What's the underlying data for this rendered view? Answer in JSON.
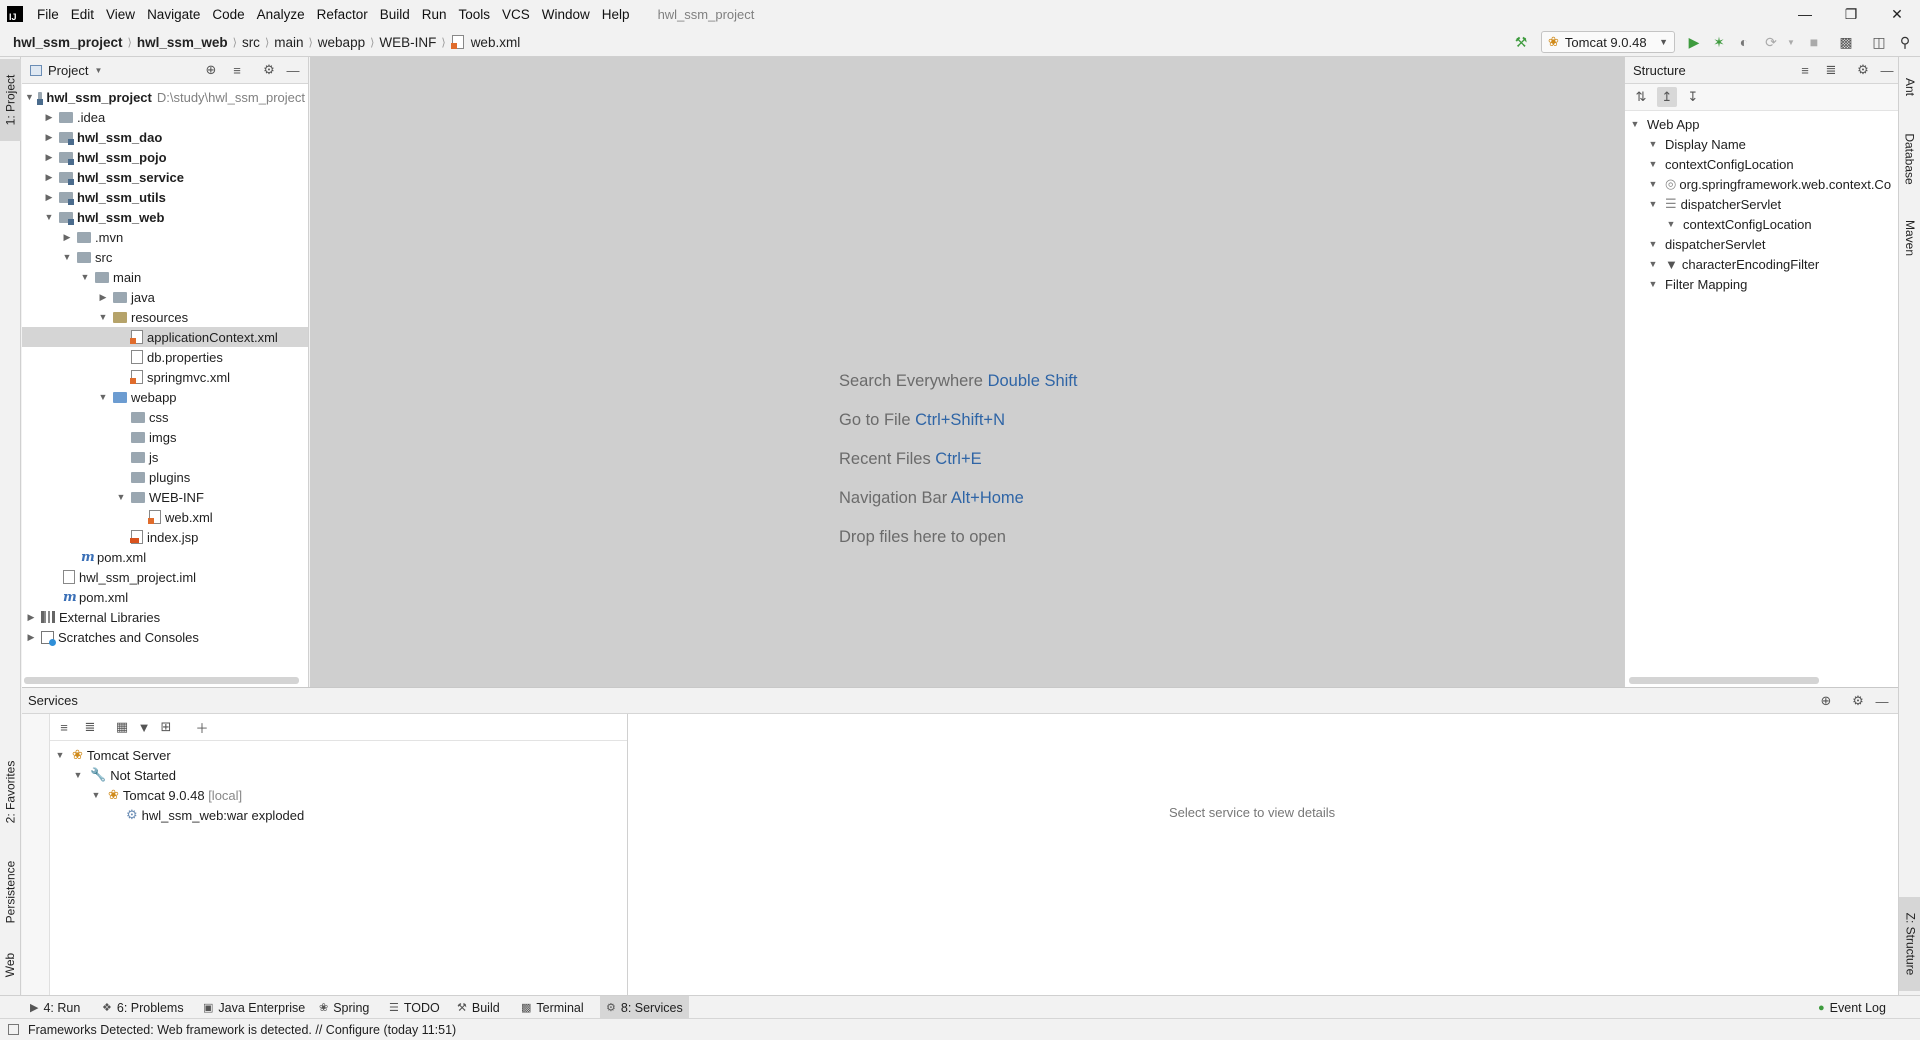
{
  "app": {
    "window_title": "hwl_ssm_project",
    "menu": [
      "File",
      "Edit",
      "View",
      "Navigate",
      "Code",
      "Analyze",
      "Refactor",
      "Build",
      "Run",
      "Tools",
      "VCS",
      "Window",
      "Help"
    ]
  },
  "breadcrumb": [
    "hwl_ssm_project",
    "hwl_ssm_web",
    "src",
    "main",
    "webapp",
    "WEB-INF",
    "web.xml"
  ],
  "run_config": {
    "label": "Tomcat 9.0.48"
  },
  "left_stripe": {
    "project": "1: Project",
    "favorites": "2: Favorites",
    "persistence": "Persistence",
    "web": "Web"
  },
  "right_stripe": {
    "ant": "Ant",
    "database": "Database",
    "maven": "Maven",
    "structure": "Z: Structure"
  },
  "project_panel": {
    "title": "Project",
    "tree": [
      {
        "label": "hwl_ssm_project",
        "path": "D:\\study\\hwl_ssm_project",
        "bold": true
      },
      {
        "label": ".idea"
      },
      {
        "label": "hwl_ssm_dao",
        "bold": true
      },
      {
        "label": "hwl_ssm_pojo",
        "bold": true
      },
      {
        "label": "hwl_ssm_service",
        "bold": true
      },
      {
        "label": "hwl_ssm_utils",
        "bold": true
      },
      {
        "label": "hwl_ssm_web",
        "bold": true
      },
      {
        "label": ".mvn"
      },
      {
        "label": "src"
      },
      {
        "label": "main"
      },
      {
        "label": "java"
      },
      {
        "label": "resources"
      },
      {
        "label": "applicationContext.xml",
        "selected": true
      },
      {
        "label": "db.properties"
      },
      {
        "label": "springmvc.xml"
      },
      {
        "label": "webapp"
      },
      {
        "label": "css"
      },
      {
        "label": "imgs"
      },
      {
        "label": "js"
      },
      {
        "label": "plugins"
      },
      {
        "label": "WEB-INF"
      },
      {
        "label": "web.xml"
      },
      {
        "label": "index.jsp"
      },
      {
        "label": "pom.xml"
      },
      {
        "label": "hwl_ssm_project.iml"
      },
      {
        "label": "pom.xml"
      },
      {
        "label": "External Libraries"
      },
      {
        "label": "Scratches and Consoles"
      }
    ]
  },
  "editor": {
    "hints": [
      {
        "text": "Search Everywhere",
        "key": "Double Shift"
      },
      {
        "text": "Go to File",
        "key": "Ctrl+Shift+N"
      },
      {
        "text": "Recent Files",
        "key": "Ctrl+E"
      },
      {
        "text": "Navigation Bar",
        "key": "Alt+Home"
      },
      {
        "text": "Drop files here to open",
        "key": ""
      }
    ]
  },
  "structure_panel": {
    "title": "Structure",
    "items": [
      "Web App",
      "Display Name",
      "contextConfigLocation",
      "org.springframework.web.context.Co",
      "dispatcherServlet",
      "contextConfigLocation",
      "dispatcherServlet",
      "characterEncodingFilter",
      "Filter Mapping"
    ]
  },
  "services": {
    "title": "Services",
    "tree": [
      {
        "label": "Tomcat Server"
      },
      {
        "label": "Not Started"
      },
      {
        "label": "Tomcat 9.0.48",
        "suffix": "[local]"
      },
      {
        "label": "hwl_ssm_web:war exploded"
      }
    ],
    "detail_placeholder": "Select service to view details"
  },
  "tool_tabs": [
    {
      "label": "4: Run",
      "icon": "run-icon"
    },
    {
      "label": "6: Problems",
      "icon": "problems-icon"
    },
    {
      "label": "Java Enterprise",
      "icon": "java-enterprise-icon"
    },
    {
      "label": "Spring",
      "icon": "spring-icon"
    },
    {
      "label": "TODO",
      "icon": "todo-icon"
    },
    {
      "label": "Build",
      "icon": "build-icon"
    },
    {
      "label": "Terminal",
      "icon": "terminal-icon"
    },
    {
      "label": "8: Services",
      "icon": "services-icon",
      "active": true
    }
  ],
  "event_log": "Event Log",
  "status": {
    "message": "Frameworks Detected: Web framework is detected. // Configure (today 11:51)"
  },
  "colors": {
    "editor_bg": "#cfcfcf",
    "accent_blue": "#2f65a6",
    "run_green": "#3e9b3e"
  }
}
